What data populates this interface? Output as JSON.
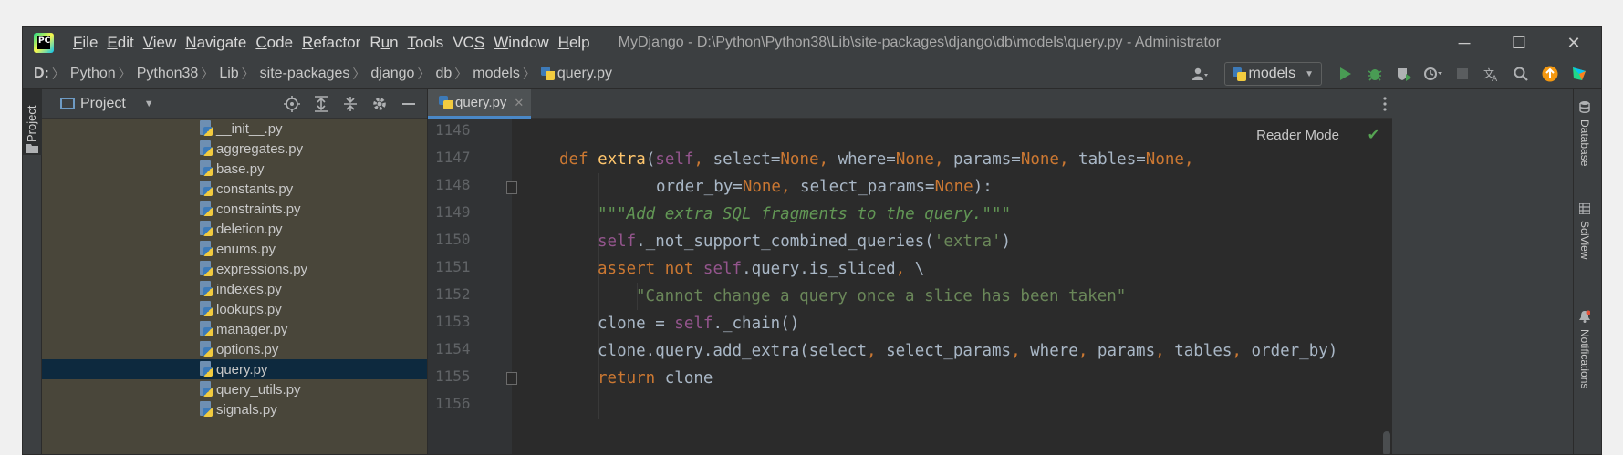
{
  "window": {
    "app_logo": "PC",
    "title": "MyDjango - D:\\Python\\Python38\\Lib\\site-packages\\django\\db\\models\\query.py - Administrator",
    "controls": {
      "minimize": "─",
      "maximize": "☐",
      "close": "✕"
    }
  },
  "menu": [
    {
      "u": "F",
      "rest": "ile"
    },
    {
      "u": "E",
      "rest": "dit"
    },
    {
      "u": "V",
      "rest": "iew"
    },
    {
      "u": "N",
      "rest": "avigate"
    },
    {
      "u": "C",
      "rest": "ode"
    },
    {
      "u": "R",
      "rest": "efactor"
    },
    {
      "pre": "R",
      "u": "u",
      "rest": "n"
    },
    {
      "u": "T",
      "rest": "ools"
    },
    {
      "pre": "VC",
      "u": "S",
      "rest": ""
    },
    {
      "u": "W",
      "rest": "indow"
    },
    {
      "u": "H",
      "rest": "elp"
    }
  ],
  "breadcrumbs": [
    "D:",
    "Python",
    "Python38",
    "Lib",
    "site-packages",
    "django",
    "db",
    "models",
    "query.py"
  ],
  "toolbar": {
    "run_config": "models",
    "icons": [
      "user-icon",
      "run-icon",
      "debug-icon",
      "coverage-icon",
      "profile-icon",
      "stop-icon",
      "translate-icon",
      "search-icon",
      "update-icon",
      "jetbrains-icon"
    ]
  },
  "left_stripe": {
    "project_label": "Project"
  },
  "project_panel": {
    "title": "Project",
    "files": [
      "__init__.py",
      "aggregates.py",
      "base.py",
      "constants.py",
      "constraints.py",
      "deletion.py",
      "enums.py",
      "expressions.py",
      "indexes.py",
      "lookups.py",
      "manager.py",
      "options.py",
      "query.py",
      "query_utils.py",
      "signals.py"
    ],
    "selected": "query.py"
  },
  "editor": {
    "tab": {
      "label": "query.py",
      "close": "✕"
    },
    "reader_mode": "Reader Mode",
    "line_numbers": [
      "1146",
      "1147",
      "1148",
      "1149",
      "1150",
      "1151",
      "1152",
      "1153",
      "1154",
      "1155",
      "1156"
    ]
  },
  "right_stripe": {
    "database": "Database",
    "sciview": "SciView",
    "notifications": "Notifications"
  },
  "colors": {
    "keyword": "#cc7832",
    "function": "#ffc66d",
    "self": "#94558d",
    "docstring": "#629755",
    "string": "#6a8759",
    "default_text": "#a9b7c6",
    "selection": "#0d293e"
  }
}
